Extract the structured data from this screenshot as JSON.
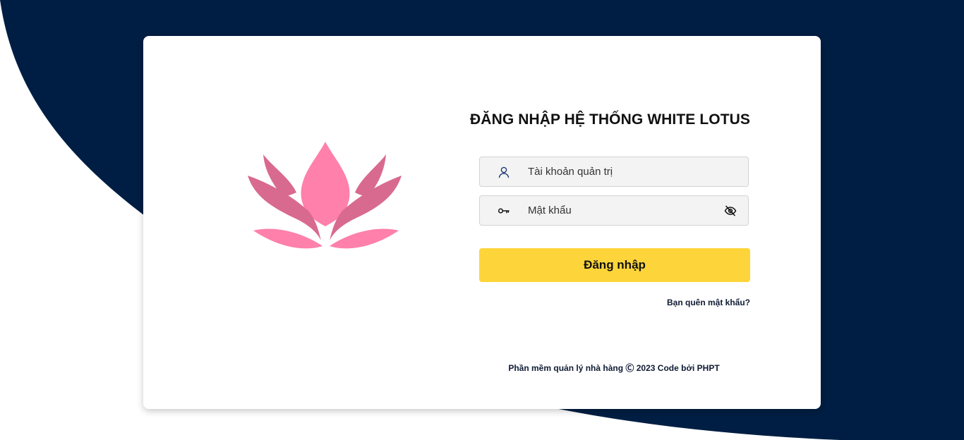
{
  "login": {
    "title": "ĐĂNG NHẬP HỆ THỐNG WHITE LOTUS",
    "username_placeholder": "Tài khoản quản trị",
    "password_placeholder": "Mật khẩu",
    "submit_label": "Đăng nhập",
    "forgot_label": "Bạn quên mật khẩu?",
    "footer_prefix": "Phần mềm quản lý nhà hàng",
    "footer_copyright": "Ⓒ",
    "footer_suffix": "2023 Code bởi PHPT"
  },
  "icons": {
    "username": "user-icon",
    "password": "key-icon",
    "toggle_password": "eye-off-icon",
    "logo": "lotus-logo"
  },
  "colors": {
    "background_dark": "#001e43",
    "card": "#ffffff",
    "button": "#fdd53a",
    "lotus_pink": "#fe80ab",
    "lotus_dark_pink": "#d96a8f",
    "text_dark": "#0e1a33"
  }
}
